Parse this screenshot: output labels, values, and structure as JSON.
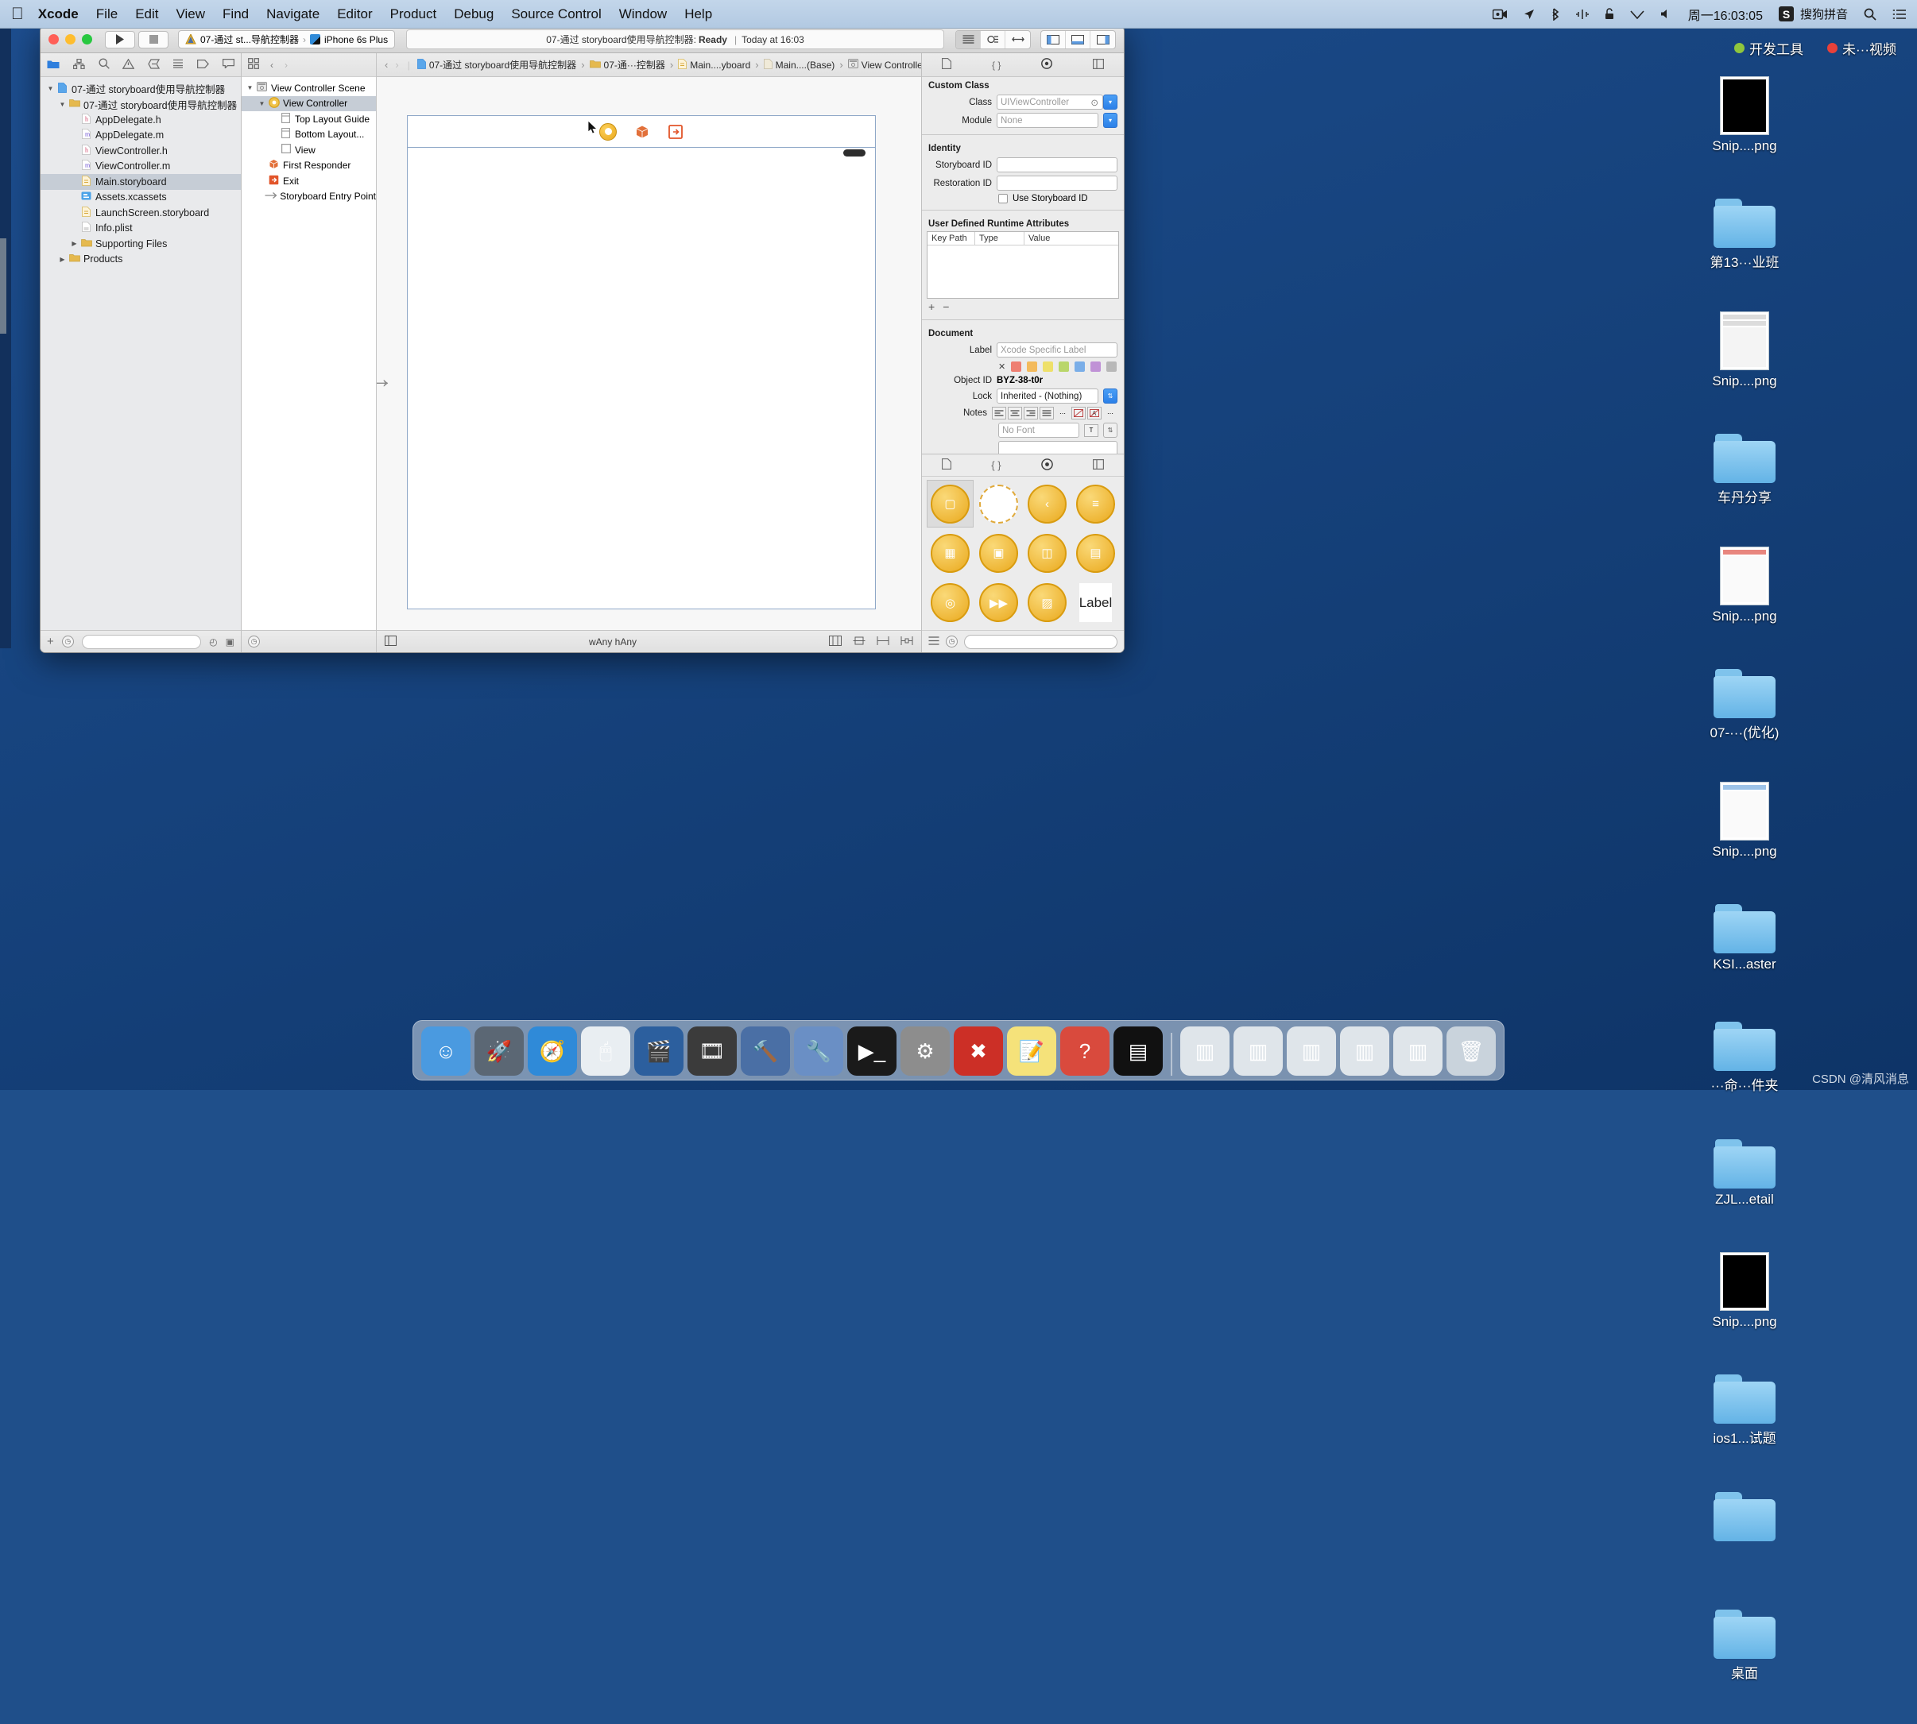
{
  "menubar": {
    "apple": "",
    "items": [
      {
        "label": "Xcode",
        "bold": true
      },
      {
        "label": "File"
      },
      {
        "label": "Edit"
      },
      {
        "label": "View"
      },
      {
        "label": "Find"
      },
      {
        "label": "Navigate"
      },
      {
        "label": "Editor"
      },
      {
        "label": "Product"
      },
      {
        "label": "Debug"
      },
      {
        "label": "Source Control"
      },
      {
        "label": "Window"
      },
      {
        "label": "Help"
      }
    ],
    "status_icons": [
      "screen-record-icon",
      "location-icon",
      "bluetooth-icon",
      "airdrop-icon",
      "lock-icon",
      "wifi-icon",
      "volume-icon"
    ],
    "clock": "周一16:03:05",
    "input_method": "搜狗拼音",
    "search_icon": "search-icon",
    "list_icon": "notification-center-icon"
  },
  "toolbar": {
    "run_icon": "▶",
    "stop_icon": "■",
    "scheme_target": "07-通过 st...导航控制器",
    "scheme_device": "iPhone 6s Plus",
    "status_project": "07-通过 storyboard使用导航控制器:",
    "status_state": "Ready",
    "status_sep": "|",
    "status_time": "Today at 16:03",
    "editor_segments": [
      "standard-editor",
      "assistant-editor",
      "version-editor"
    ],
    "view_segments": [
      "navigator-toggle",
      "debug-toggle",
      "utilities-toggle"
    ]
  },
  "navigator": {
    "tabs": [
      "folder-icon",
      "source-control-icon",
      "search-icon",
      "warning-icon",
      "breakpoint-icon",
      "test-icon",
      "tag-icon",
      "report-icon"
    ],
    "active_tab": 0,
    "tree": [
      {
        "label": "07-通过 storyboard使用导航控制器",
        "indent": 0,
        "twisty": "▼",
        "icon": "project-icon",
        "icolor": "#3b8fe0",
        "selected": false
      },
      {
        "label": "07-通过 storyboard使用导航控制器",
        "indent": 1,
        "twisty": "▼",
        "icon": "folder-icon",
        "icolor": "#e5b94e",
        "selected": false
      },
      {
        "label": "AppDelegate.h",
        "indent": 2,
        "twisty": "",
        "icon": "h-file-icon",
        "icolor": "#d04a6e",
        "selected": false
      },
      {
        "label": "AppDelegate.m",
        "indent": 2,
        "twisty": "",
        "icon": "m-file-icon",
        "icolor": "#6a4ed0",
        "selected": false
      },
      {
        "label": "ViewController.h",
        "indent": 2,
        "twisty": "",
        "icon": "h-file-icon",
        "icolor": "#d04a6e",
        "selected": false
      },
      {
        "label": "ViewController.m",
        "indent": 2,
        "twisty": "",
        "icon": "m-file-icon",
        "icolor": "#6a4ed0",
        "selected": false
      },
      {
        "label": "Main.storyboard",
        "indent": 2,
        "twisty": "",
        "icon": "storyboard-icon",
        "icolor": "#e5b94e",
        "selected": true
      },
      {
        "label": "Assets.xcassets",
        "indent": 2,
        "twisty": "",
        "icon": "assets-icon",
        "icolor": "#3b8fe0",
        "selected": false
      },
      {
        "label": "LaunchScreen.storyboard",
        "indent": 2,
        "twisty": "",
        "icon": "storyboard-icon",
        "icolor": "#e5b94e",
        "selected": false
      },
      {
        "label": "Info.plist",
        "indent": 2,
        "twisty": "",
        "icon": "plist-icon",
        "icolor": "#b9b9b9",
        "selected": false
      },
      {
        "label": "Supporting Files",
        "indent": 2,
        "twisty": "▶",
        "icon": "folder-icon",
        "icolor": "#e5b94e",
        "selected": false
      },
      {
        "label": "Products",
        "indent": 1,
        "twisty": "▶",
        "icon": "folder-icon",
        "icolor": "#e5b94e",
        "selected": false
      }
    ],
    "add_button": "+",
    "filter_placeholder": ""
  },
  "outline": {
    "header_icons": [
      "grid-icon",
      "back-chevron-icon",
      "forward-chevron-icon"
    ],
    "tree": [
      {
        "label": "View Controller Scene",
        "indent": 0,
        "twisty": "▼",
        "icon": "scene-icon",
        "icolor": "#8a8a8a",
        "selected": false
      },
      {
        "label": "View Controller",
        "indent": 1,
        "twisty": "▼",
        "icon": "view-controller-icon",
        "icolor": "#e9a81c",
        "selected": true
      },
      {
        "label": "Top Layout Guide",
        "indent": 2,
        "twisty": "",
        "icon": "layout-guide-icon",
        "icolor": "#9a9a9a",
        "selected": false
      },
      {
        "label": "Bottom Layout...",
        "indent": 2,
        "twisty": "",
        "icon": "layout-guide-icon",
        "icolor": "#9a9a9a",
        "selected": false
      },
      {
        "label": "View",
        "indent": 2,
        "twisty": "",
        "icon": "view-icon",
        "icolor": "#9a9a9a",
        "selected": false
      },
      {
        "label": "First Responder",
        "indent": 1,
        "twisty": "",
        "icon": "first-responder-icon",
        "icolor": "#e2703a",
        "selected": false
      },
      {
        "label": "Exit",
        "indent": 1,
        "twisty": "",
        "icon": "exit-icon",
        "icolor": "#e2552a",
        "selected": false
      },
      {
        "label": "Storyboard Entry Point",
        "indent": 1,
        "twisty": "",
        "icon": "entry-point-icon",
        "icolor": "#9a9a9a",
        "selected": false
      }
    ]
  },
  "jumpbar": {
    "back": "‹",
    "forward": "›",
    "crumbs": [
      {
        "label": "07-通过 storyboard使用导航控制器",
        "icon": "project-icon",
        "icolor": "#3b8fe0"
      },
      {
        "label": "07-通···控制器",
        "icon": "folder-icon",
        "icolor": "#e5b94e"
      },
      {
        "label": "Main....yboard",
        "icon": "storyboard-icon",
        "icolor": "#c9c9c9"
      },
      {
        "label": "Main....(Base)",
        "icon": "file-icon",
        "icolor": "#c9c9c9"
      },
      {
        "label": "View Controller Scene",
        "icon": "scene-icon",
        "icolor": "#8a8a8a"
      },
      {
        "label": "View Controller",
        "icon": "view-controller-icon",
        "icolor": "#e9a81c"
      }
    ],
    "right_icons": [
      "page-icon",
      "help-icon",
      "related-icon",
      "pin-icon",
      "device-icon",
      "assistant-icon"
    ]
  },
  "canvas": {
    "device_toolbar_icons": [
      "view-controller-dot-icon",
      "first-responder-icon",
      "exit-icon"
    ],
    "entry_arrow": "→",
    "bottom": {
      "outline_toggle": "□",
      "size_class": "wAny hAny",
      "right_icons": [
        "constraints-icon",
        "align-icon",
        "pin-icon",
        "resolve-icon"
      ]
    }
  },
  "inspector": {
    "tabs": [
      "file-inspector-icon",
      "quick-help-icon",
      "identity-inspector-icon",
      "attributes-inspector-icon",
      "size-inspector-icon",
      "connections-inspector-icon"
    ],
    "active_tab": 2,
    "custom_class": {
      "title": "Custom Class",
      "class_label": "Class",
      "class_value": "UIViewController",
      "module_label": "Module",
      "module_value": "None"
    },
    "identity": {
      "title": "Identity",
      "storyboard_id_label": "Storyboard ID",
      "storyboard_id_value": "",
      "restoration_id_label": "Restoration ID",
      "restoration_id_value": "",
      "use_storyboard_id_label": "Use Storyboard ID",
      "use_storyboard_id_checked": false
    },
    "runtime_attrs": {
      "title": "User Defined Runtime Attributes",
      "columns": [
        "Key Path",
        "Type",
        "Value"
      ],
      "rows": [],
      "add": "+",
      "remove": "−"
    },
    "document": {
      "title": "Document",
      "label_label": "Label",
      "label_placeholder": "Xcode Specific Label",
      "swatch_clear": "✕",
      "swatches": [
        "#ee7f72",
        "#f3ba5c",
        "#eee06a",
        "#b9d66a",
        "#7aaee8",
        "#c092d6",
        "#b8b8b8"
      ],
      "object_id_label": "Object ID",
      "object_id_value": "BYZ-38-t0r",
      "lock_label": "Lock",
      "lock_value": "Inherited - (Nothing)",
      "notes_label": "Notes",
      "font_placeholder": "No Font"
    }
  },
  "library": {
    "tabs": [
      "file-template-library-icon",
      "code-snippet-library-icon",
      "object-library-icon",
      "media-library-icon"
    ],
    "active_tab": 2,
    "items": [
      {
        "name": "view-controller-object",
        "glyph": "▢",
        "selected": true
      },
      {
        "name": "storyboard-reference-object",
        "glyph": "▢",
        "selected": false
      },
      {
        "name": "navigation-controller-object",
        "glyph": "‹",
        "selected": false
      },
      {
        "name": "table-view-controller-object",
        "glyph": "≡",
        "selected": false
      },
      {
        "name": "collection-view-controller-object",
        "glyph": "▦",
        "selected": false
      },
      {
        "name": "tab-bar-controller-object",
        "glyph": "▣",
        "selected": false
      },
      {
        "name": "split-view-controller-object",
        "glyph": "◫",
        "selected": false
      },
      {
        "name": "page-view-controller-object",
        "glyph": "▤",
        "selected": false
      },
      {
        "name": "glkit-view-controller-object",
        "glyph": "◎",
        "selected": false
      },
      {
        "name": "avkit-player-controller-object",
        "glyph": "▶▶",
        "selected": false
      },
      {
        "name": "object-cube",
        "glyph": "▨",
        "selected": false
      },
      {
        "name": "label-object",
        "glyph": "Label",
        "selected": false
      }
    ],
    "filter_placeholder": ""
  },
  "desktop": {
    "top_labels": [
      {
        "text": "开发工具",
        "dot": "#8fc63d"
      },
      {
        "text": "未···视频",
        "dot": "#e8413a"
      }
    ],
    "icons": [
      {
        "label": "Snip....png",
        "type": "png-dark"
      },
      {
        "label": "第13···业班",
        "type": "folder"
      },
      {
        "label": "Snip....png",
        "type": "png-light"
      },
      {
        "label": "车丹分享",
        "type": "folder"
      },
      {
        "label": "Snip....png",
        "type": "png-red"
      },
      {
        "label": "07-···(优化)",
        "type": "folder"
      },
      {
        "label": "Snip....png",
        "type": "png-blue"
      },
      {
        "label": "KSI...aster",
        "type": "folder"
      },
      {
        "label": "···命···件夹",
        "type": "folder"
      },
      {
        "label": "ZJL...etail",
        "type": "folder"
      },
      {
        "label": "Snip....png",
        "type": "png-dark"
      },
      {
        "label": "ios1...试题",
        "type": "folder"
      },
      {
        "label": "",
        "type": "folder"
      },
      {
        "label": "桌面",
        "type": "folder"
      }
    ]
  },
  "dock": {
    "items": [
      {
        "name": "finder",
        "glyph": "☺",
        "color": "#4a9ae0"
      },
      {
        "name": "launchpad",
        "glyph": "🚀",
        "color": "#5b6774"
      },
      {
        "name": "safari",
        "glyph": "🧭",
        "color": "#2f8ad8"
      },
      {
        "name": "mouse-app",
        "glyph": "🖱",
        "color": "#e9eef2"
      },
      {
        "name": "screenflow",
        "glyph": "🎬",
        "color": "#2c5f9e"
      },
      {
        "name": "video-app",
        "glyph": "🎞",
        "color": "#3b3b3b"
      },
      {
        "name": "xcode",
        "glyph": "🔨",
        "color": "#4a6fa5"
      },
      {
        "name": "xcode-beta",
        "glyph": "🔧",
        "color": "#6a8fc5"
      },
      {
        "name": "terminal",
        "glyph": "▶_",
        "color": "#1a1a1a"
      },
      {
        "name": "system-preferences",
        "glyph": "⚙",
        "color": "#8d8d8d"
      },
      {
        "name": "xmind",
        "glyph": "✖",
        "color": "#cc2f26"
      },
      {
        "name": "notes",
        "glyph": "📝",
        "color": "#f5e27a"
      },
      {
        "name": "help",
        "glyph": "?",
        "color": "#d94a3d"
      },
      {
        "name": "exec-app",
        "glyph": "▤",
        "color": "#111111"
      },
      {
        "name": "window-1",
        "glyph": "▥",
        "color": "#dfe5ea"
      },
      {
        "name": "window-2",
        "glyph": "▥",
        "color": "#dfe5ea"
      },
      {
        "name": "window-3",
        "glyph": "▥",
        "color": "#dfe5ea"
      },
      {
        "name": "window-4",
        "glyph": "▥",
        "color": "#dfe5ea"
      },
      {
        "name": "window-5",
        "glyph": "▥",
        "color": "#dfe5ea"
      },
      {
        "name": "trash",
        "glyph": "🗑",
        "color": "#c9d3dc"
      }
    ]
  },
  "watermark": "CSDN @清风消息"
}
